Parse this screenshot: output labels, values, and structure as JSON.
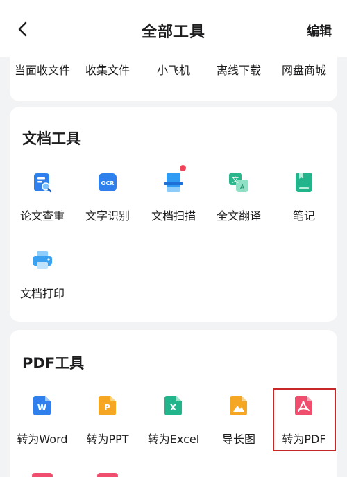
{
  "header": {
    "title": "全部工具",
    "edit_label": "编辑"
  },
  "top_tools": [
    "当面收文件",
    "收集文件",
    "小飞机",
    "离线下载",
    "网盘商城"
  ],
  "doc_section": {
    "title": "文档工具",
    "tools": [
      {
        "label": "论文查重",
        "icon": "paper-check-icon",
        "color": "#2f80ed"
      },
      {
        "label": "文字识别",
        "icon": "ocr-icon",
        "color": "#2f80ed"
      },
      {
        "label": "文档扫描",
        "icon": "scan-icon",
        "color": "#2f9bf2"
      },
      {
        "label": "全文翻译",
        "icon": "translate-icon",
        "color": "#2bb58a"
      },
      {
        "label": "笔记",
        "icon": "note-icon",
        "color": "#22b58c"
      },
      {
        "label": "文档打印",
        "icon": "printer-icon",
        "color": "#3aa0f0"
      }
    ],
    "ocr_text": "OCR",
    "translate_glyph_a": "文",
    "translate_glyph_b": "A"
  },
  "pdf_section": {
    "title": "PDF工具",
    "tools": [
      {
        "label": "转为Word",
        "icon": "word-icon",
        "color": "#2f80ed",
        "glyph": "W"
      },
      {
        "label": "转为PPT",
        "icon": "ppt-icon",
        "color": "#f5a623",
        "glyph": "P"
      },
      {
        "label": "转为Excel",
        "icon": "excel-icon",
        "color": "#22b58c",
        "glyph": "X"
      },
      {
        "label": "导长图",
        "icon": "long-image-icon",
        "color": "#f5a623"
      },
      {
        "label": "转为PDF",
        "icon": "pdf-icon",
        "color": "#f04e6e"
      }
    ]
  },
  "colors": {
    "highlight": "#c62828",
    "badge": "#f2435a"
  }
}
